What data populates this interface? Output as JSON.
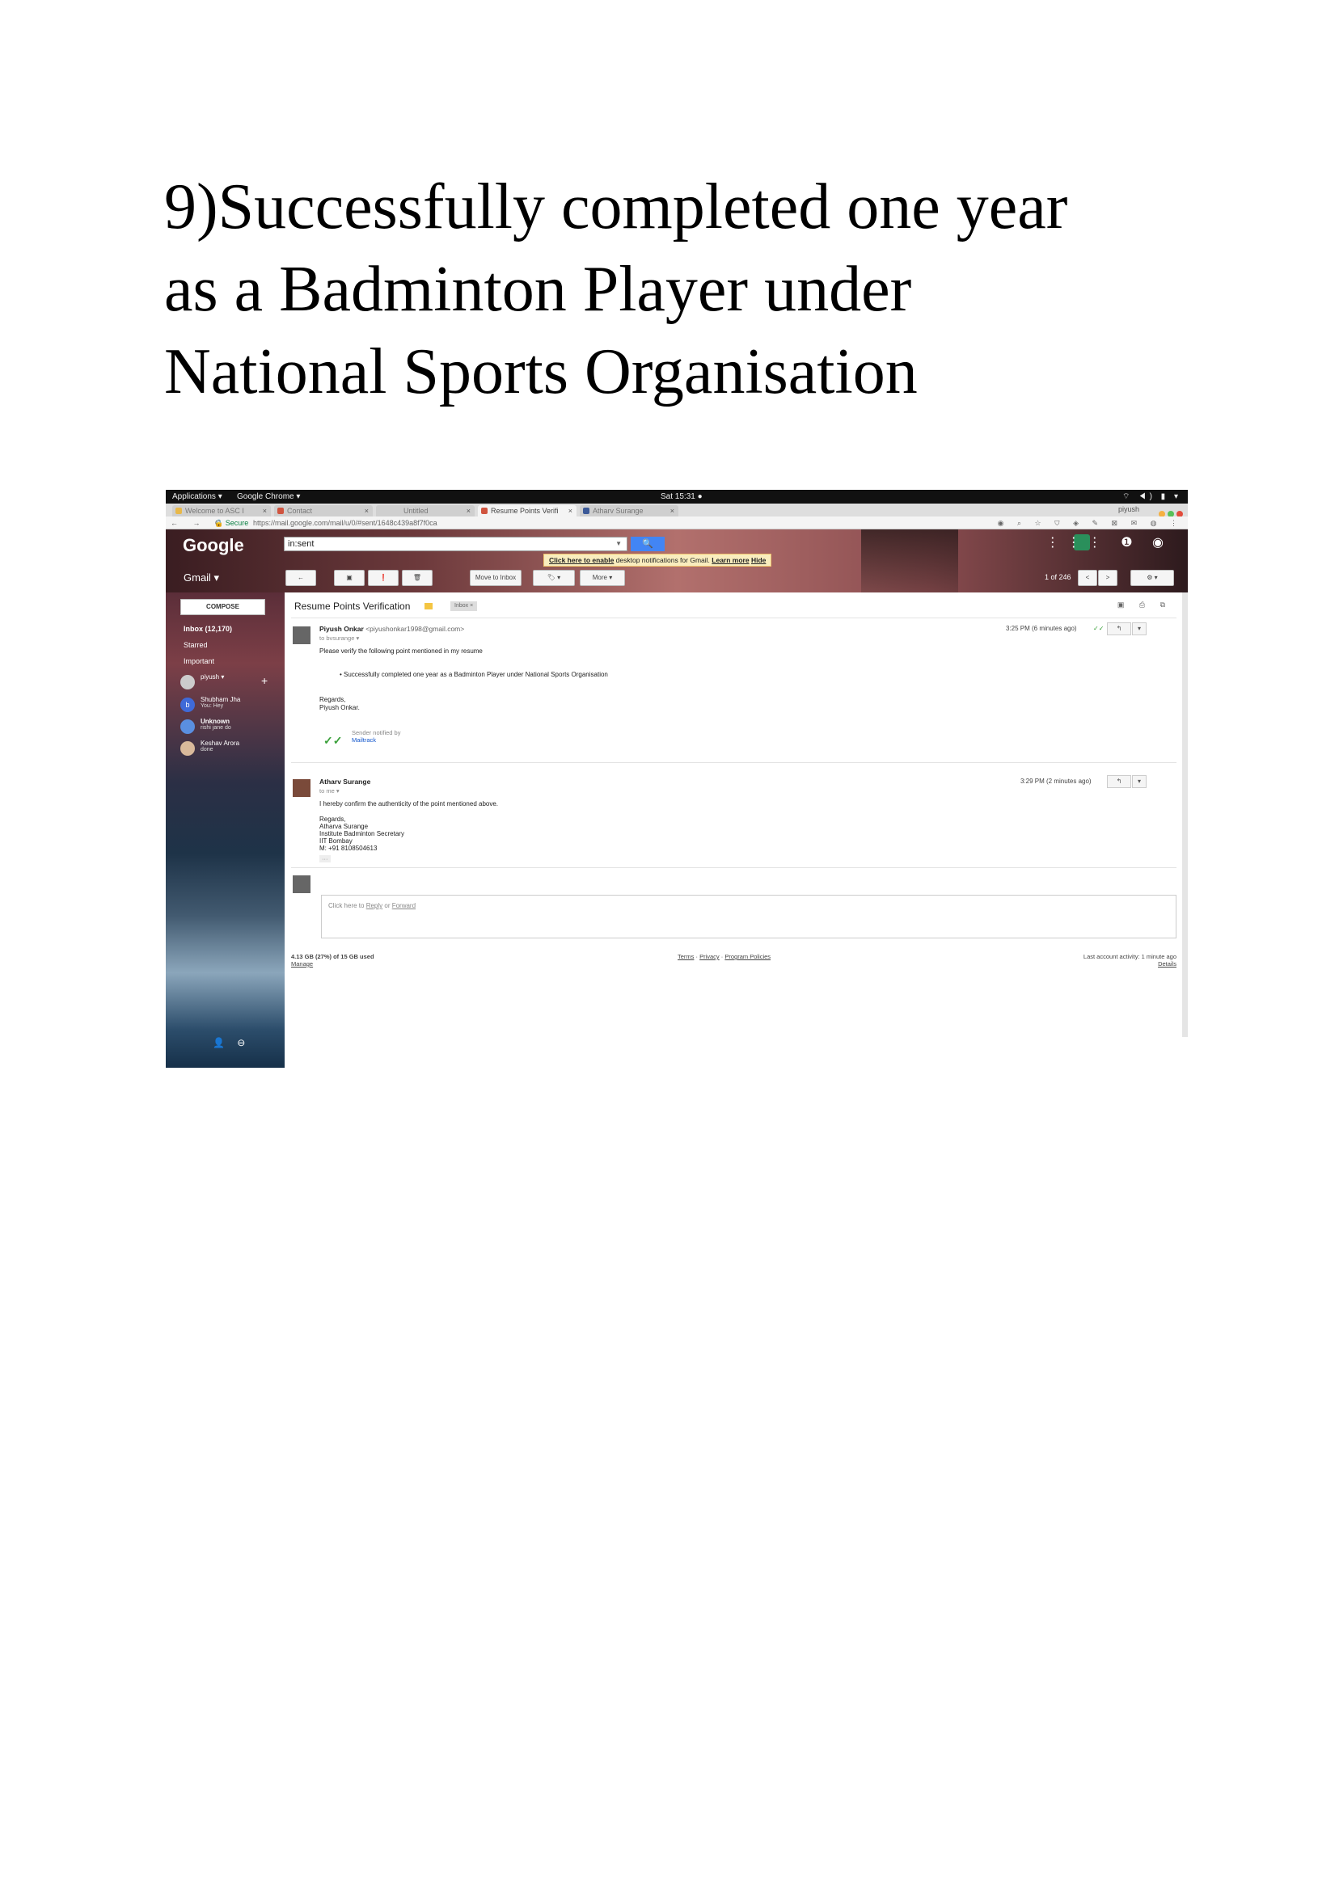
{
  "heading": {
    "line1": "9)Successfully completed one year",
    "line2": "as a Badminton Player under",
    "line3": "National Sports Organisation"
  },
  "os_bar": {
    "applications": "Applications ▾",
    "browser": "Google Chrome ▾",
    "clock": "Sat 15:31 ●",
    "system_icons": "⌔ ◀) ▮ ▾"
  },
  "tabs": [
    {
      "label": "Welcome to ASC I",
      "favicon_color": "#e8b84a"
    },
    {
      "label": "Contact",
      "favicon_color": "#d0543f"
    },
    {
      "label": "Untitled",
      "favicon_color": "#cfcfcf"
    },
    {
      "label": "Resume Points Verifi",
      "favicon_color": "#d0543f"
    },
    {
      "label": "Atharv Surange",
      "favicon_color": "#3b5998"
    }
  ],
  "browser_user": "piyush",
  "address": {
    "nav": "← → C",
    "secure": "🔒 Secure",
    "url": "https://mail.google.com/mail/u/0/#sent/1648c439a8f7f0ca",
    "ext_icons": "◉ ⌕ ☆ ⛉ ◈ ✎ ⊠ ✉ ◍ ⋮"
  },
  "gmail": {
    "logo": "Google",
    "product": "Gmail ▾",
    "search_value": "in:sent",
    "search_button": "🔍",
    "notice_link": "Click here to enable",
    "notice_text": " desktop notifications for Gmail.",
    "learn_more": "Learn more",
    "hide": "Hide",
    "toolbar": {
      "back": "←",
      "archive": "▣",
      "spam": "❗",
      "delete": "🗑",
      "move_to_inbox": "Move to Inbox",
      "labels": "🏷 ▾",
      "more": "More ▾"
    },
    "counter": "1 of 246",
    "prev": "<",
    "next": ">",
    "settings": "⚙ ▾",
    "header_icons": "⋮⋮⋮ ❶ ◉"
  },
  "sidebar": {
    "compose": "COMPOSE",
    "items": [
      {
        "label": "Inbox (12,170)",
        "bold": true
      },
      {
        "label": "Starred",
        "bold": false
      },
      {
        "label": "Important",
        "bold": false
      }
    ],
    "account": "piyush ▾",
    "plus": "+",
    "hangouts": [
      {
        "name": "Shubham Jha",
        "sub": "You: Hey",
        "avatar_letter": "b",
        "avatar_color": "#3f6ad8"
      },
      {
        "name": "Unknown",
        "sub": "rishi jane do",
        "avatar_letter": "",
        "avatar_color": "#5a8fe0"
      },
      {
        "name": "Keshav Arora",
        "sub": "done",
        "avatar_letter": "",
        "avatar_color": "#d9b99b"
      }
    ],
    "footer_icons": "👤 ⊖"
  },
  "thread": {
    "subject": "Resume Points Verification",
    "inbox_chip": "Inbox ×",
    "subject_icons": "▣ ⎙ ⧉",
    "messages": [
      {
        "sender_name": "Piyush Onkar",
        "sender_email": "<piyushonkar1998@gmail.com>",
        "to": "to bvsurange ▾",
        "time": "3:25 PM (6 minutes ago)",
        "lines": [
          "Please verify the following point mentioned in my resume",
          "•   Successfully completed one year as a Badminton Player under National Sports Organisation",
          "Regards,",
          "Piyush Onkar."
        ],
        "tracker_text": "Sender notified by",
        "tracker_link": "Mailtrack",
        "tracker_check": "✓✓"
      },
      {
        "sender_name": "Atharv Surange",
        "to": "to me ▾",
        "time": "3:29 PM (2 minutes ago)",
        "lines": [
          "I hereby confirm the authenticity of the point mentioned above.",
          "Regards,",
          "Atharva Surange",
          "Institute Badminton Secretary",
          "IIT Bombay",
          "M: +91 8108504613"
        ],
        "ellipsis": "···"
      }
    ],
    "reply_prefix": "Click here to ",
    "reply_link": "Reply",
    "reply_or": " or ",
    "forward_link": "Forward",
    "reply_icon": "↰",
    "menu_icon": "▾",
    "storage": "4.13 GB (27%) of 15 GB used",
    "manage": "Manage",
    "terms": "Terms",
    "privacy": "Privacy",
    "policies": "Program Policies",
    "activity": "Last account activity: 1 minute ago",
    "details": "Details"
  }
}
